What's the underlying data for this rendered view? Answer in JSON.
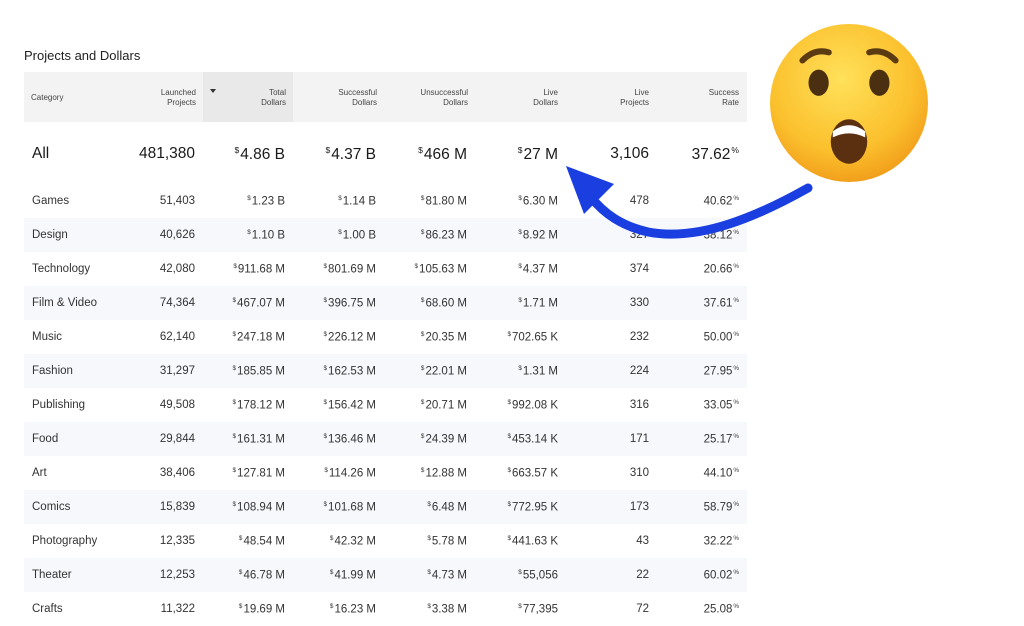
{
  "title": "Projects and Dollars",
  "headers": [
    {
      "l1": "Category",
      "l2": ""
    },
    {
      "l1": "Launched",
      "l2": "Projects"
    },
    {
      "l1": "Total",
      "l2": "Dollars"
    },
    {
      "l1": "Successful",
      "l2": "Dollars"
    },
    {
      "l1": "Unsuccessful",
      "l2": "Dollars"
    },
    {
      "l1": "Live",
      "l2": "Dollars"
    },
    {
      "l1": "Live",
      "l2": "Projects"
    },
    {
      "l1": "Success",
      "l2": "Rate"
    }
  ],
  "all_row": {
    "category": "All",
    "launched": "481,380",
    "total": "4.86 B",
    "successful": "4.37 B",
    "unsuccessful": "466 M",
    "live_dollars": "27 M",
    "live_projects": "3,106",
    "rate": "37.62"
  },
  "rows": [
    {
      "category": "Games",
      "launched": "51,403",
      "total": "1.23 B",
      "successful": "1.14 B",
      "unsuccessful": "81.80 M",
      "live_dollars": "6.30 M",
      "live_projects": "478",
      "rate": "40.62"
    },
    {
      "category": "Design",
      "launched": "40,626",
      "total": "1.10 B",
      "successful": "1.00 B",
      "unsuccessful": "86.23 M",
      "live_dollars": "8.92 M",
      "live_projects": "327",
      "rate": "38.12"
    },
    {
      "category": "Technology",
      "launched": "42,080",
      "total": "911.68 M",
      "successful": "801.69 M",
      "unsuccessful": "105.63 M",
      "live_dollars": "4.37 M",
      "live_projects": "374",
      "rate": "20.66"
    },
    {
      "category": "Film & Video",
      "launched": "74,364",
      "total": "467.07 M",
      "successful": "396.75 M",
      "unsuccessful": "68.60 M",
      "live_dollars": "1.71 M",
      "live_projects": "330",
      "rate": "37.61"
    },
    {
      "category": "Music",
      "launched": "62,140",
      "total": "247.18 M",
      "successful": "226.12 M",
      "unsuccessful": "20.35 M",
      "live_dollars": "702.65 K",
      "live_projects": "232",
      "rate": "50.00"
    },
    {
      "category": "Fashion",
      "launched": "31,297",
      "total": "185.85 M",
      "successful": "162.53 M",
      "unsuccessful": "22.01 M",
      "live_dollars": "1.31 M",
      "live_projects": "224",
      "rate": "27.95"
    },
    {
      "category": "Publishing",
      "launched": "49,508",
      "total": "178.12 M",
      "successful": "156.42 M",
      "unsuccessful": "20.71 M",
      "live_dollars": "992.08 K",
      "live_projects": "316",
      "rate": "33.05"
    },
    {
      "category": "Food",
      "launched": "29,844",
      "total": "161.31 M",
      "successful": "136.46 M",
      "unsuccessful": "24.39 M",
      "live_dollars": "453.14 K",
      "live_projects": "171",
      "rate": "25.17"
    },
    {
      "category": "Art",
      "launched": "38,406",
      "total": "127.81 M",
      "successful": "114.26 M",
      "unsuccessful": "12.88 M",
      "live_dollars": "663.57 K",
      "live_projects": "310",
      "rate": "44.10"
    },
    {
      "category": "Comics",
      "launched": "15,839",
      "total": "108.94 M",
      "successful": "101.68 M",
      "unsuccessful": "6.48 M",
      "live_dollars": "772.95 K",
      "live_projects": "173",
      "rate": "58.79"
    },
    {
      "category": "Photography",
      "launched": "12,335",
      "total": "48.54 M",
      "successful": "42.32 M",
      "unsuccessful": "5.78 M",
      "live_dollars": "441.63 K",
      "live_projects": "43",
      "rate": "32.22"
    },
    {
      "category": "Theater",
      "launched": "12,253",
      "total": "46.78 M",
      "successful": "41.99 M",
      "unsuccessful": "4.73 M",
      "live_dollars": "55,056",
      "live_projects": "22",
      "rate": "60.02"
    },
    {
      "category": "Crafts",
      "launched": "11,322",
      "total": "19.69 M",
      "successful": "16.23 M",
      "unsuccessful": "3.38 M",
      "live_dollars": "77,395",
      "live_projects": "72",
      "rate": "25.08"
    }
  ],
  "symbols": {
    "dollar": "$",
    "percent": "%"
  },
  "colors": {
    "arrow": "#1a3ee0",
    "header_bg": "#f3f3f3",
    "alt_row_bg": "#f7f8fb"
  },
  "icons": {
    "emoji": "astonished-face-icon",
    "arrow": "curved-arrow-icon",
    "sort": "sort-caret-icon"
  }
}
